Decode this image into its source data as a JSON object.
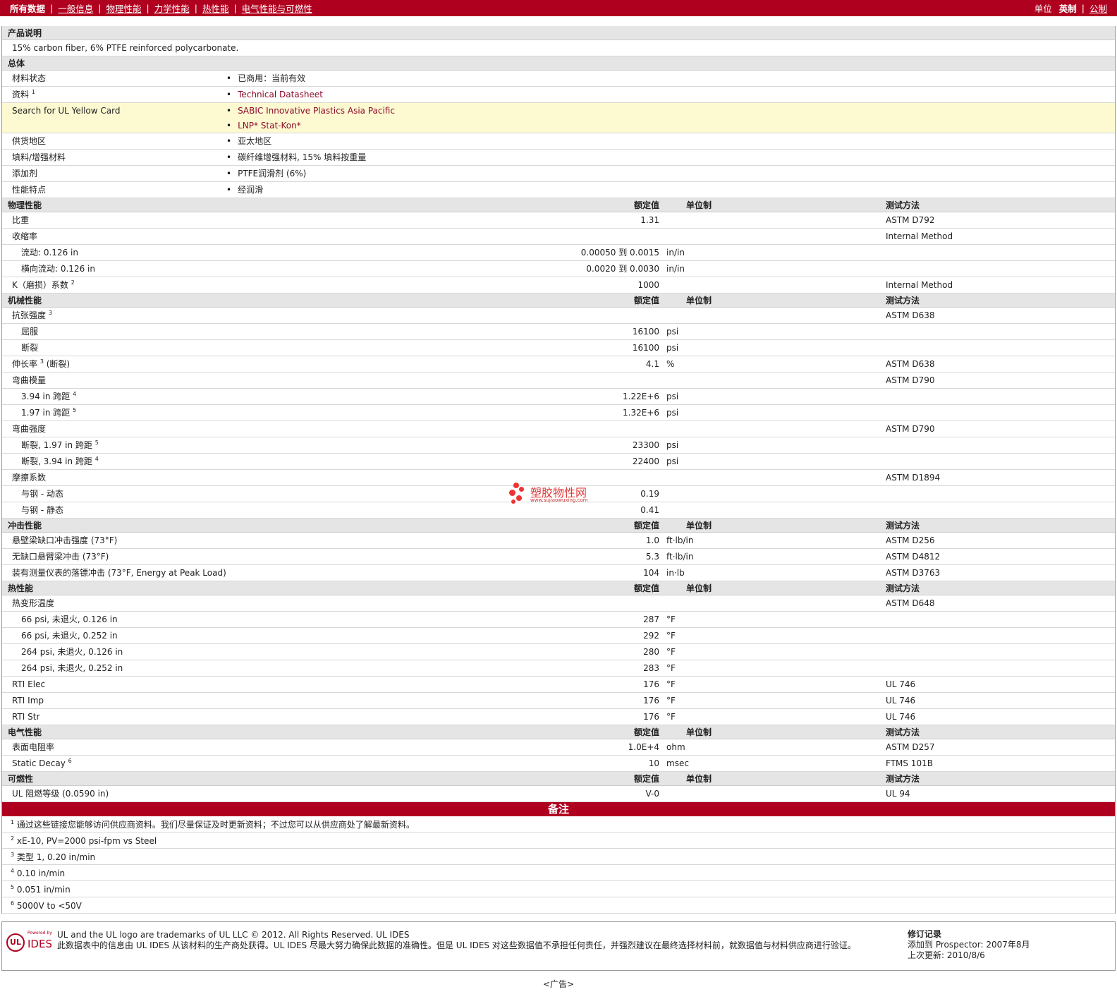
{
  "nav": {
    "items": [
      "所有数据",
      "一般信息",
      "物理性能",
      "力学性能",
      "热性能",
      "电气性能与可燃性"
    ],
    "units_label": "单位",
    "units_selected": "英制",
    "units_other": "公制"
  },
  "desc": {
    "title": "产品说明",
    "text": "15% carbon fiber, 6% PTFE reinforced polycarbonate."
  },
  "general": {
    "title": "总体",
    "status_label": "材料状态",
    "status_value": "已商用：当前有效",
    "docs_label": "资料",
    "docs_sup": "1",
    "docs_value": "Technical Datasheet",
    "ul_label": "Search for UL Yellow Card",
    "ul_values": [
      "SABIC Innovative Plastics Asia Pacific",
      "LNP* Stat-Kon*"
    ],
    "region_label": "供货地区",
    "region_value": "亚太地区",
    "filler_label": "填料/增强材料",
    "filler_value": "碳纤维增强材料, 15% 填料按重量",
    "additive_label": "添加剂",
    "additive_value": "PTFE润滑剂 (6%)",
    "feature_label": "性能特点",
    "feature_value": "经润滑"
  },
  "col": {
    "value": "额定值",
    "unit": "单位制",
    "test": "测试方法"
  },
  "physical": {
    "title": "物理性能",
    "rows": [
      {
        "label": "比重",
        "sup": "",
        "sub": false,
        "value": "1.31",
        "unit": "",
        "test": "ASTM D792"
      },
      {
        "label": "收缩率",
        "sup": "",
        "sub": false,
        "value": "",
        "unit": "",
        "test": "Internal Method"
      },
      {
        "label": "流动: 0.126 in",
        "sup": "",
        "sub": true,
        "value": "0.00050 到  0.0015",
        "unit": "in/in",
        "test": ""
      },
      {
        "label": "横向流动: 0.126 in",
        "sup": "",
        "sub": true,
        "value": "0.0020 到  0.0030",
        "unit": "in/in",
        "test": ""
      },
      {
        "label": "K（磨损）系数",
        "sup": "2",
        "sub": false,
        "value": "1000",
        "unit": "",
        "test": "Internal Method"
      }
    ]
  },
  "mechanical": {
    "title": "机械性能",
    "rows": [
      {
        "label": "抗张强度",
        "sup": "3",
        "sub": false,
        "value": "",
        "unit": "",
        "test": "ASTM D638"
      },
      {
        "label": "屈服",
        "sup": "",
        "sub": true,
        "value": "16100",
        "unit": "psi",
        "test": ""
      },
      {
        "label": "断裂",
        "sup": "",
        "sub": true,
        "value": "16100",
        "unit": "psi",
        "test": ""
      },
      {
        "label": "伸长率",
        "sup": "3",
        "post": " (断裂)",
        "sub": false,
        "value": "4.1",
        "unit": "%",
        "test": "ASTM D638"
      },
      {
        "label": "弯曲模量",
        "sup": "",
        "sub": false,
        "value": "",
        "unit": "",
        "test": "ASTM D790"
      },
      {
        "label": "3.94 in 跨距",
        "sup": "4",
        "sub": true,
        "value": "1.22E+6",
        "unit": "psi",
        "test": ""
      },
      {
        "label": "1.97 in 跨距",
        "sup": "5",
        "sub": true,
        "value": "1.32E+6",
        "unit": "psi",
        "test": ""
      },
      {
        "label": "弯曲强度",
        "sup": "",
        "sub": false,
        "value": "",
        "unit": "",
        "test": "ASTM D790"
      },
      {
        "label": "断裂, 1.97 in 跨距",
        "sup": "5",
        "sub": true,
        "value": "23300",
        "unit": "psi",
        "test": ""
      },
      {
        "label": "断裂, 3.94 in 跨距",
        "sup": "4",
        "sub": true,
        "value": "22400",
        "unit": "psi",
        "test": ""
      },
      {
        "label": "摩擦系数",
        "sup": "",
        "sub": false,
        "value": "",
        "unit": "",
        "test": "ASTM D1894"
      },
      {
        "label": "与钢 - 动态",
        "sup": "",
        "sub": true,
        "value": "0.19",
        "unit": "",
        "test": ""
      },
      {
        "label": "与钢 - 静态",
        "sup": "",
        "sub": true,
        "value": "0.41",
        "unit": "",
        "test": ""
      }
    ]
  },
  "impact": {
    "title": "冲击性能",
    "rows": [
      {
        "label": "悬壁梁缺口冲击强度 (73°F)",
        "sup": "",
        "sub": false,
        "value": "1.0",
        "unit": "ft·lb/in",
        "test": "ASTM D256"
      },
      {
        "label": "无缺口悬臂梁冲击 (73°F)",
        "sup": "",
        "sub": false,
        "value": "5.3",
        "unit": "ft·lb/in",
        "test": "ASTM D4812"
      },
      {
        "label": "装有测量仪表的落镖冲击 (73°F, Energy at Peak Load)",
        "sup": "",
        "sub": false,
        "value": "104",
        "unit": "in·lb",
        "test": "ASTM D3763"
      }
    ]
  },
  "thermal": {
    "title": "热性能",
    "rows": [
      {
        "label": "热变形温度",
        "sup": "",
        "sub": false,
        "value": "",
        "unit": "",
        "test": "ASTM D648"
      },
      {
        "label": "66 psi, 未退火, 0.126 in",
        "sup": "",
        "sub": true,
        "value": "287",
        "unit": "°F",
        "test": ""
      },
      {
        "label": "66 psi, 未退火, 0.252 in",
        "sup": "",
        "sub": true,
        "value": "292",
        "unit": "°F",
        "test": ""
      },
      {
        "label": "264 psi, 未退火, 0.126 in",
        "sup": "",
        "sub": true,
        "value": "280",
        "unit": "°F",
        "test": ""
      },
      {
        "label": "264 psi, 未退火, 0.252 in",
        "sup": "",
        "sub": true,
        "value": "283",
        "unit": "°F",
        "test": ""
      },
      {
        "label": "RTI Elec",
        "sup": "",
        "sub": false,
        "value": "176",
        "unit": "°F",
        "test": "UL 746"
      },
      {
        "label": "RTI Imp",
        "sup": "",
        "sub": false,
        "value": "176",
        "unit": "°F",
        "test": "UL 746"
      },
      {
        "label": "RTI Str",
        "sup": "",
        "sub": false,
        "value": "176",
        "unit": "°F",
        "test": "UL 746"
      }
    ]
  },
  "electrical": {
    "title": "电气性能",
    "rows": [
      {
        "label": "表面电阻率",
        "sup": "",
        "sub": false,
        "value": "1.0E+4",
        "unit": "ohm",
        "test": "ASTM D257"
      },
      {
        "label": "Static Decay",
        "sup": "6",
        "sub": false,
        "value": "10",
        "unit": "msec",
        "test": "FTMS 101B"
      }
    ]
  },
  "flammability": {
    "title": "可燃性",
    "rows": [
      {
        "label": "UL 阻燃等级 (0.0590 in)",
        "sup": "",
        "sub": false,
        "value": "V-0",
        "unit": "",
        "test": "UL 94"
      }
    ]
  },
  "notes": {
    "title": "备注",
    "items": [
      {
        "num": "1",
        "text": "通过这些链接您能够访问供应商资料。我们尽量保证及时更新资料；不过您可以从供应商处了解最新资料。"
      },
      {
        "num": "2",
        "text": "xE-10, PV=2000 psi-fpm vs Steel"
      },
      {
        "num": "3",
        "text": "类型  1, 0.20 in/min"
      },
      {
        "num": "4",
        "text": "0.10 in/min"
      },
      {
        "num": "5",
        "text": "0.051 in/min"
      },
      {
        "num": "6",
        "text": "5000V to <50V"
      }
    ]
  },
  "footer": {
    "logo_ul": "UL",
    "logo_powered": "Powered by",
    "logo_ides": "IDES",
    "line1": "UL and the UL logo are trademarks of UL LLC © 2012. All Rights Reserved. UL IDES",
    "line2": "此数据表中的信息由  UL IDES 从该材料的生产商处获得。UL IDES 尽最大努力确保此数据的准确性。但是  UL IDES 对这些数据值不承担任何责任，并强烈建议在最终选择材料前，就数据值与材料供应商进行验证。",
    "rev_title": "修订记录",
    "rev_added": "添加到  Prospector:   2007年8月",
    "rev_updated": "上次更新:    2010/8/6",
    "ad": "<广告>"
  },
  "watermark": {
    "text": "塑胶物性网",
    "url": "www.sujiaowuxing.com"
  },
  "colors": {
    "brand": "#b0001f",
    "link": "#8c0a2a",
    "header_bg": "#e5e5e5",
    "highlight": "#fdfad2"
  }
}
